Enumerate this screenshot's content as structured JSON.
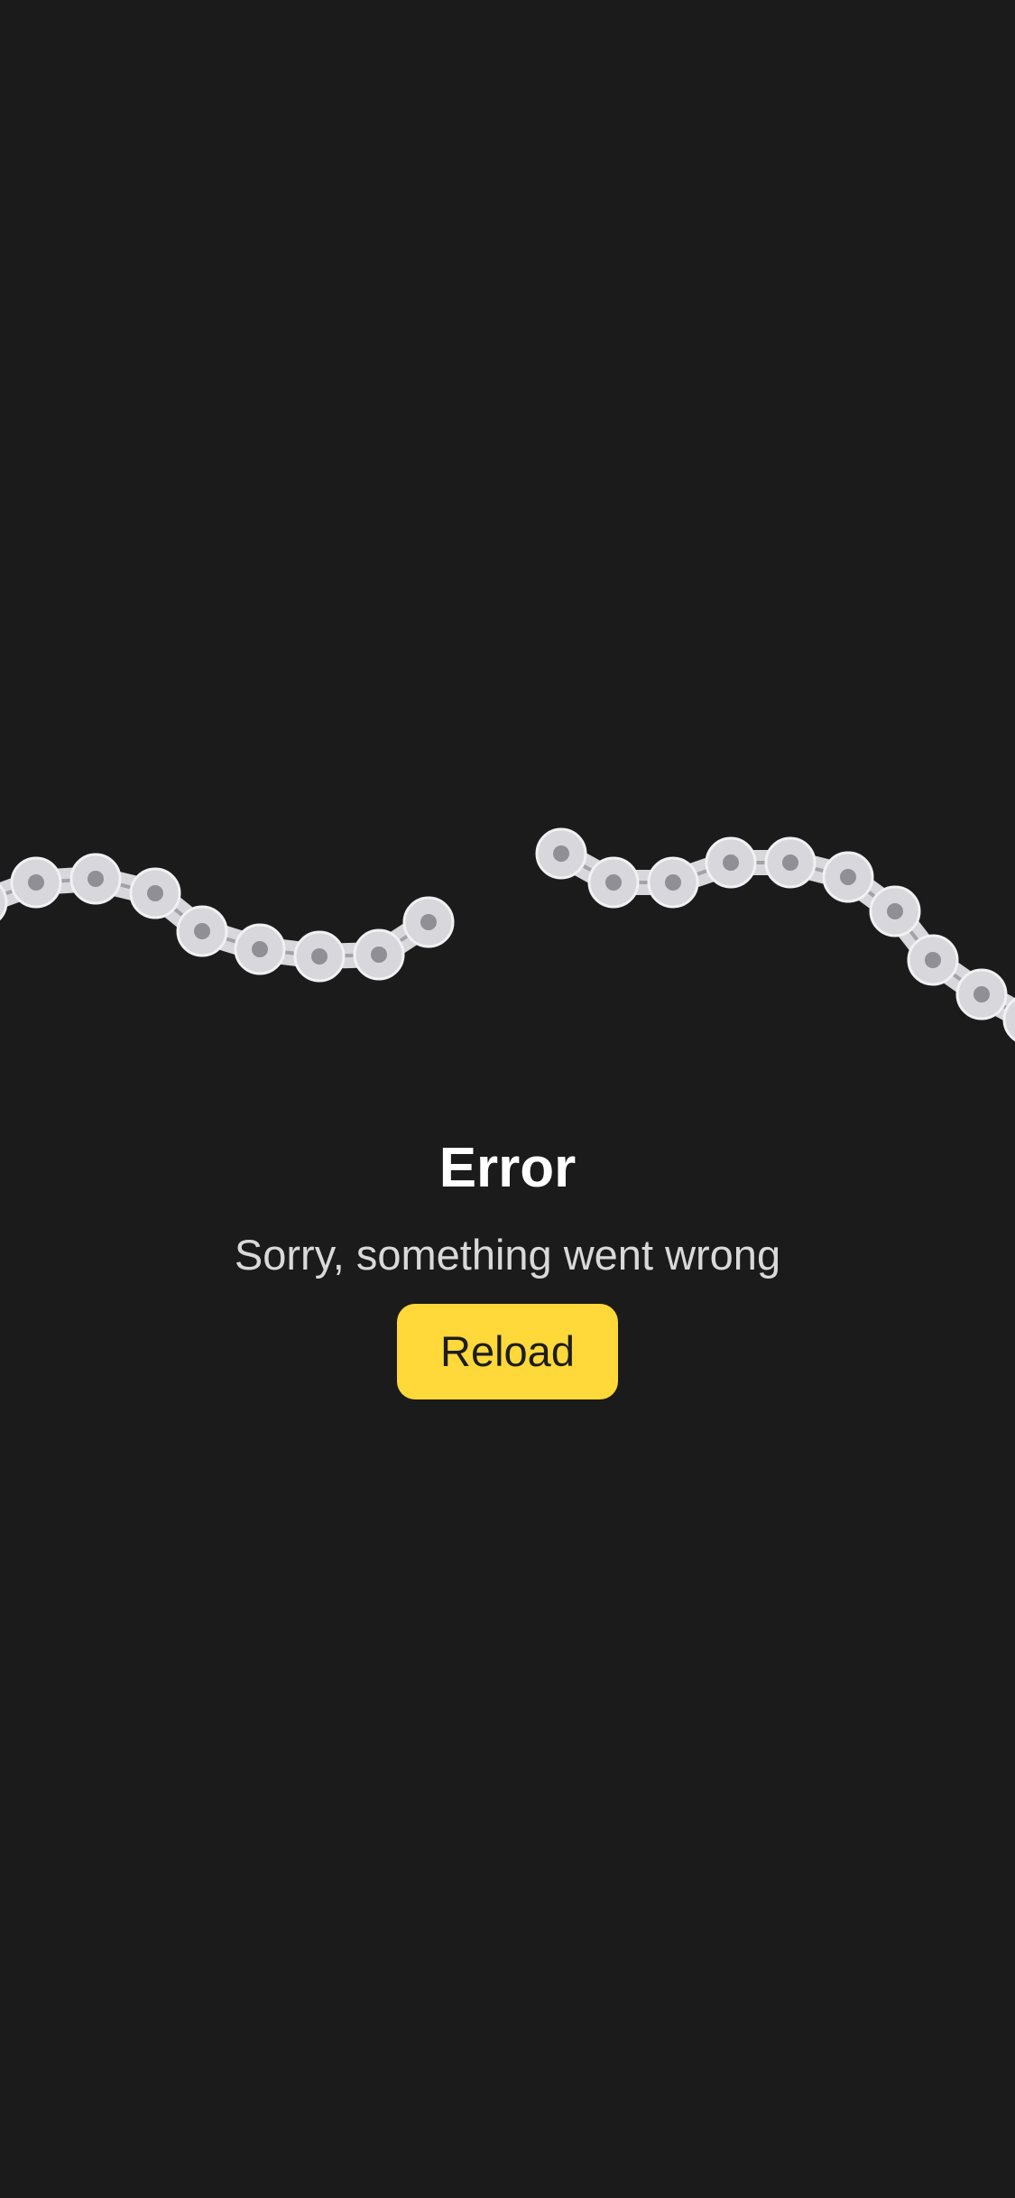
{
  "error": {
    "title": "Error",
    "message": "Sorry, something went wrong",
    "reload_label": "Reload"
  },
  "colors": {
    "background": "#1b1b1b",
    "accent": "#ffd83a",
    "chain_link": "#d7d7dc",
    "chain_pin": "#8f8f95"
  },
  "icons": {
    "illustration": "broken-chain-icon"
  }
}
